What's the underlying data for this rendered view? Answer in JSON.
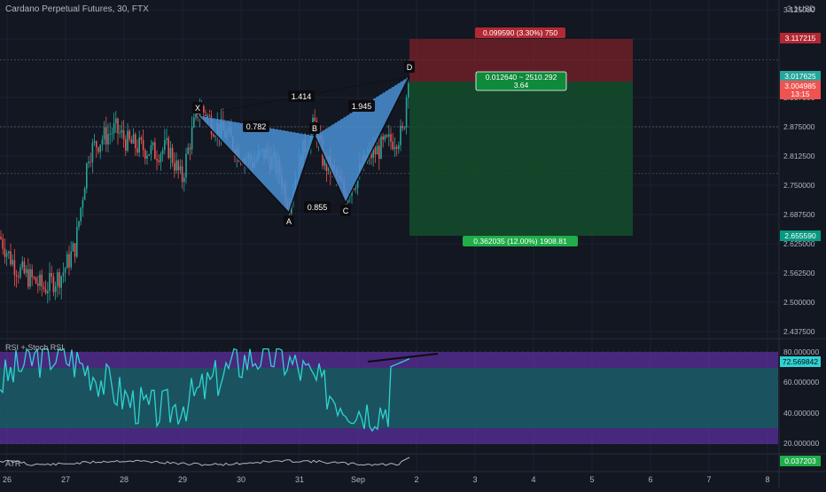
{
  "header": {
    "symbol_line": "Cardano Perpetual Futures, 30, FTX",
    "currency": "USD"
  },
  "price_axis": {
    "ticks": [
      "3.125000",
      "3.062500",
      "2.937500",
      "2.875000",
      "2.812500",
      "2.750000",
      "2.687500",
      "2.625000",
      "2.562500",
      "2.500000",
      "2.437500"
    ],
    "top_partial": "3.1",
    "labels": [
      {
        "text": "3.117215",
        "bg": "#b22833"
      },
      {
        "text": "3.017625",
        "bg": "#26a69a"
      },
      {
        "text": "3.004985",
        "bg": "#ef5350"
      },
      {
        "text": "13:15",
        "bg": "#ef5350"
      },
      {
        "text": "2.655590",
        "bg": "#089981"
      }
    ]
  },
  "position": {
    "stop_label": "0.099590 (3.30%) 750",
    "entry_label_line1": "0.012640 ~ 2510.292",
    "entry_label_line2": "3.64",
    "target_label": "0.362035 (12.00%) 1908.81",
    "entry": 3.017625,
    "stop": 3.117215,
    "target": 2.65559
  },
  "pattern": {
    "points": {
      "X": 2.942,
      "A": 2.704,
      "B": 2.888,
      "C": 2.721,
      "D": 3.025
    },
    "ratios": [
      "1.414",
      "0.782",
      "1.945",
      "0.855"
    ]
  },
  "rsi": {
    "title": "RSI + Stoch RSI",
    "ticks": [
      "80.000000",
      "60.000000",
      "40.000000",
      "20.000000"
    ],
    "value": "72.569842"
  },
  "atr": {
    "title": "ATR",
    "value": "0.037203"
  },
  "time_axis": [
    "26",
    "27",
    "28",
    "29",
    "30",
    "31",
    "Sep",
    "2",
    "3",
    "4",
    "5",
    "6",
    "7",
    "8"
  ],
  "chart_data": {
    "type": "line",
    "title": "Cardano Perpetual Futures, 30, FTX",
    "x": [
      "26",
      "27",
      "28",
      "29",
      "30",
      "31",
      "Sep",
      "2"
    ],
    "series": [
      {
        "values": [
          2.6,
          2.52,
          2.85,
          2.87,
          2.78,
          2.76,
          2.84,
          3.0
        ]
      }
    ],
    "ylim": [
      2.4375,
      3.125
    ]
  },
  "colors": {
    "bg": "#131722",
    "up": "#26a69a",
    "down": "#ef5350",
    "pattern_fill": "#4a8fd4",
    "rsi_line": "#2ed3d3"
  }
}
